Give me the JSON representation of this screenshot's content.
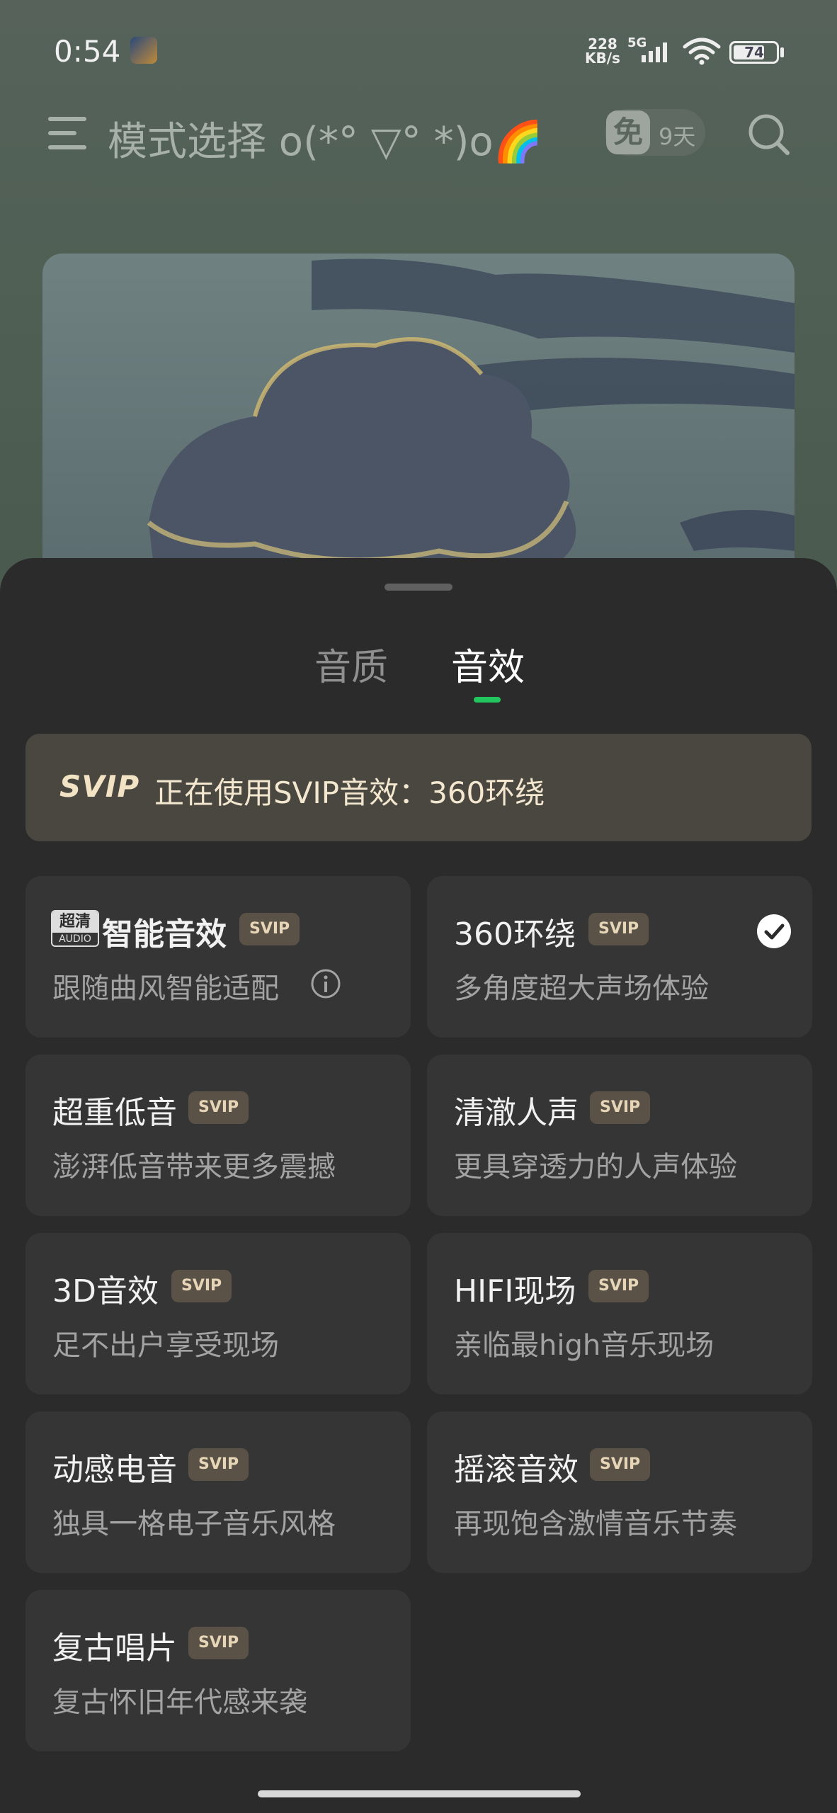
{
  "status_bar": {
    "time": "0:54",
    "net_speed_value": "228",
    "net_speed_unit": "KB/s",
    "network": "5G",
    "battery": "74",
    "battery_level": 0.74
  },
  "header": {
    "title": "模式选择 o(*°  ▽°  *)o🌈",
    "free_label": "免",
    "free_days": "9天"
  },
  "tabs": [
    {
      "label": "音质",
      "active": false
    },
    {
      "label": "音效",
      "active": true
    }
  ],
  "banner": {
    "logo": "SVIP",
    "text": "正在使用SVIP音效：360环绕"
  },
  "effects": [
    {
      "title": "智能音效",
      "tag": "SVIP",
      "desc": "跟随曲风智能适配",
      "hq_top": "超清",
      "hq_bottom": "AUDIO"
    },
    {
      "title": "360环绕",
      "tag": "SVIP",
      "desc": "多角度超大声场体验",
      "selected": true
    },
    {
      "title": "超重低音",
      "tag": "SVIP",
      "desc": "澎湃低音带来更多震撼"
    },
    {
      "title": "清澈人声",
      "tag": "SVIP",
      "desc": "更具穿透力的人声体验"
    },
    {
      "title": "3D音效",
      "tag": "SVIP",
      "desc": "足不出户享受现场"
    },
    {
      "title": "HIFI现场",
      "tag": "SVIP",
      "desc": "亲临最high音乐现场"
    },
    {
      "title": "动感电音",
      "tag": "SVIP",
      "desc": "独具一格电子音乐风格"
    },
    {
      "title": "摇滚音效",
      "tag": "SVIP",
      "desc": "再现饱含激情音乐节奏"
    },
    {
      "title": "复古唱片",
      "tag": "SVIP",
      "desc": "复古怀旧年代感来袭"
    }
  ]
}
